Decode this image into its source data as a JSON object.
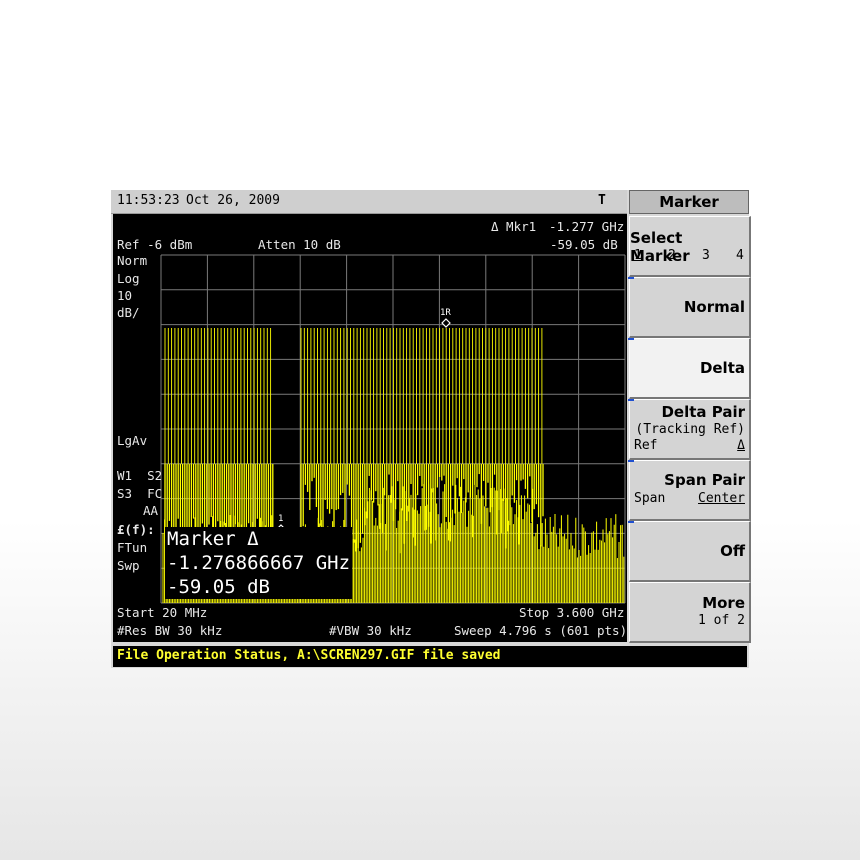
{
  "header": {
    "time": "11:53:23",
    "date": "Oct 26, 2009",
    "trigger": "T"
  },
  "marker_readout": {
    "label": "Δ Mkr1",
    "freq": "-1.277 GHz",
    "level": "-59.05 dB"
  },
  "left_info": {
    "ref": "Ref -6 dBm",
    "atten": "Atten 10 dB",
    "norm": "Norm",
    "log": "Log",
    "scale": "10",
    "unit": "dB/",
    "lgav": "LgAv",
    "w1s2": "W1  S2",
    "s3fc": "S3  FC",
    "aa": "AA",
    "ff": "£(f):",
    "ftun": "FTun",
    "swp": "Swp"
  },
  "marker_box": {
    "title": "Marker Δ",
    "freq": "-1.276866667 GHz",
    "level": "-59.05 dB"
  },
  "marker_labels": {
    "ref_marker": "1R",
    "marker": "1"
  },
  "footer": {
    "start": "Start 20 MHz",
    "stop": "Stop 3.600 GHz",
    "rbw": "#Res BW 30 kHz",
    "vbw": "#VBW 30 kHz",
    "sweep": "Sweep 4.796 s (601 pts)"
  },
  "status": "File Operation Status, A:\\SCREN297.GIF file saved",
  "menu": {
    "title": "Marker",
    "select_marker": {
      "label": "Select Marker",
      "options": [
        "1",
        "2",
        "3",
        "4"
      ],
      "selected": "1"
    },
    "normal": "Normal",
    "delta": "Delta",
    "delta_pair": {
      "label": "Delta Pair",
      "sub": "(Tracking Ref)",
      "left": "Ref",
      "right": "Δ"
    },
    "span_pair": {
      "label": "Span Pair",
      "left": "Span",
      "right": "Center"
    },
    "off": "Off",
    "more": {
      "label": "More",
      "sub": "1 of 2"
    }
  },
  "colors": {
    "trace": "#ffff00",
    "status_text": "#ffff30",
    "screen_bg": "#000000"
  }
}
